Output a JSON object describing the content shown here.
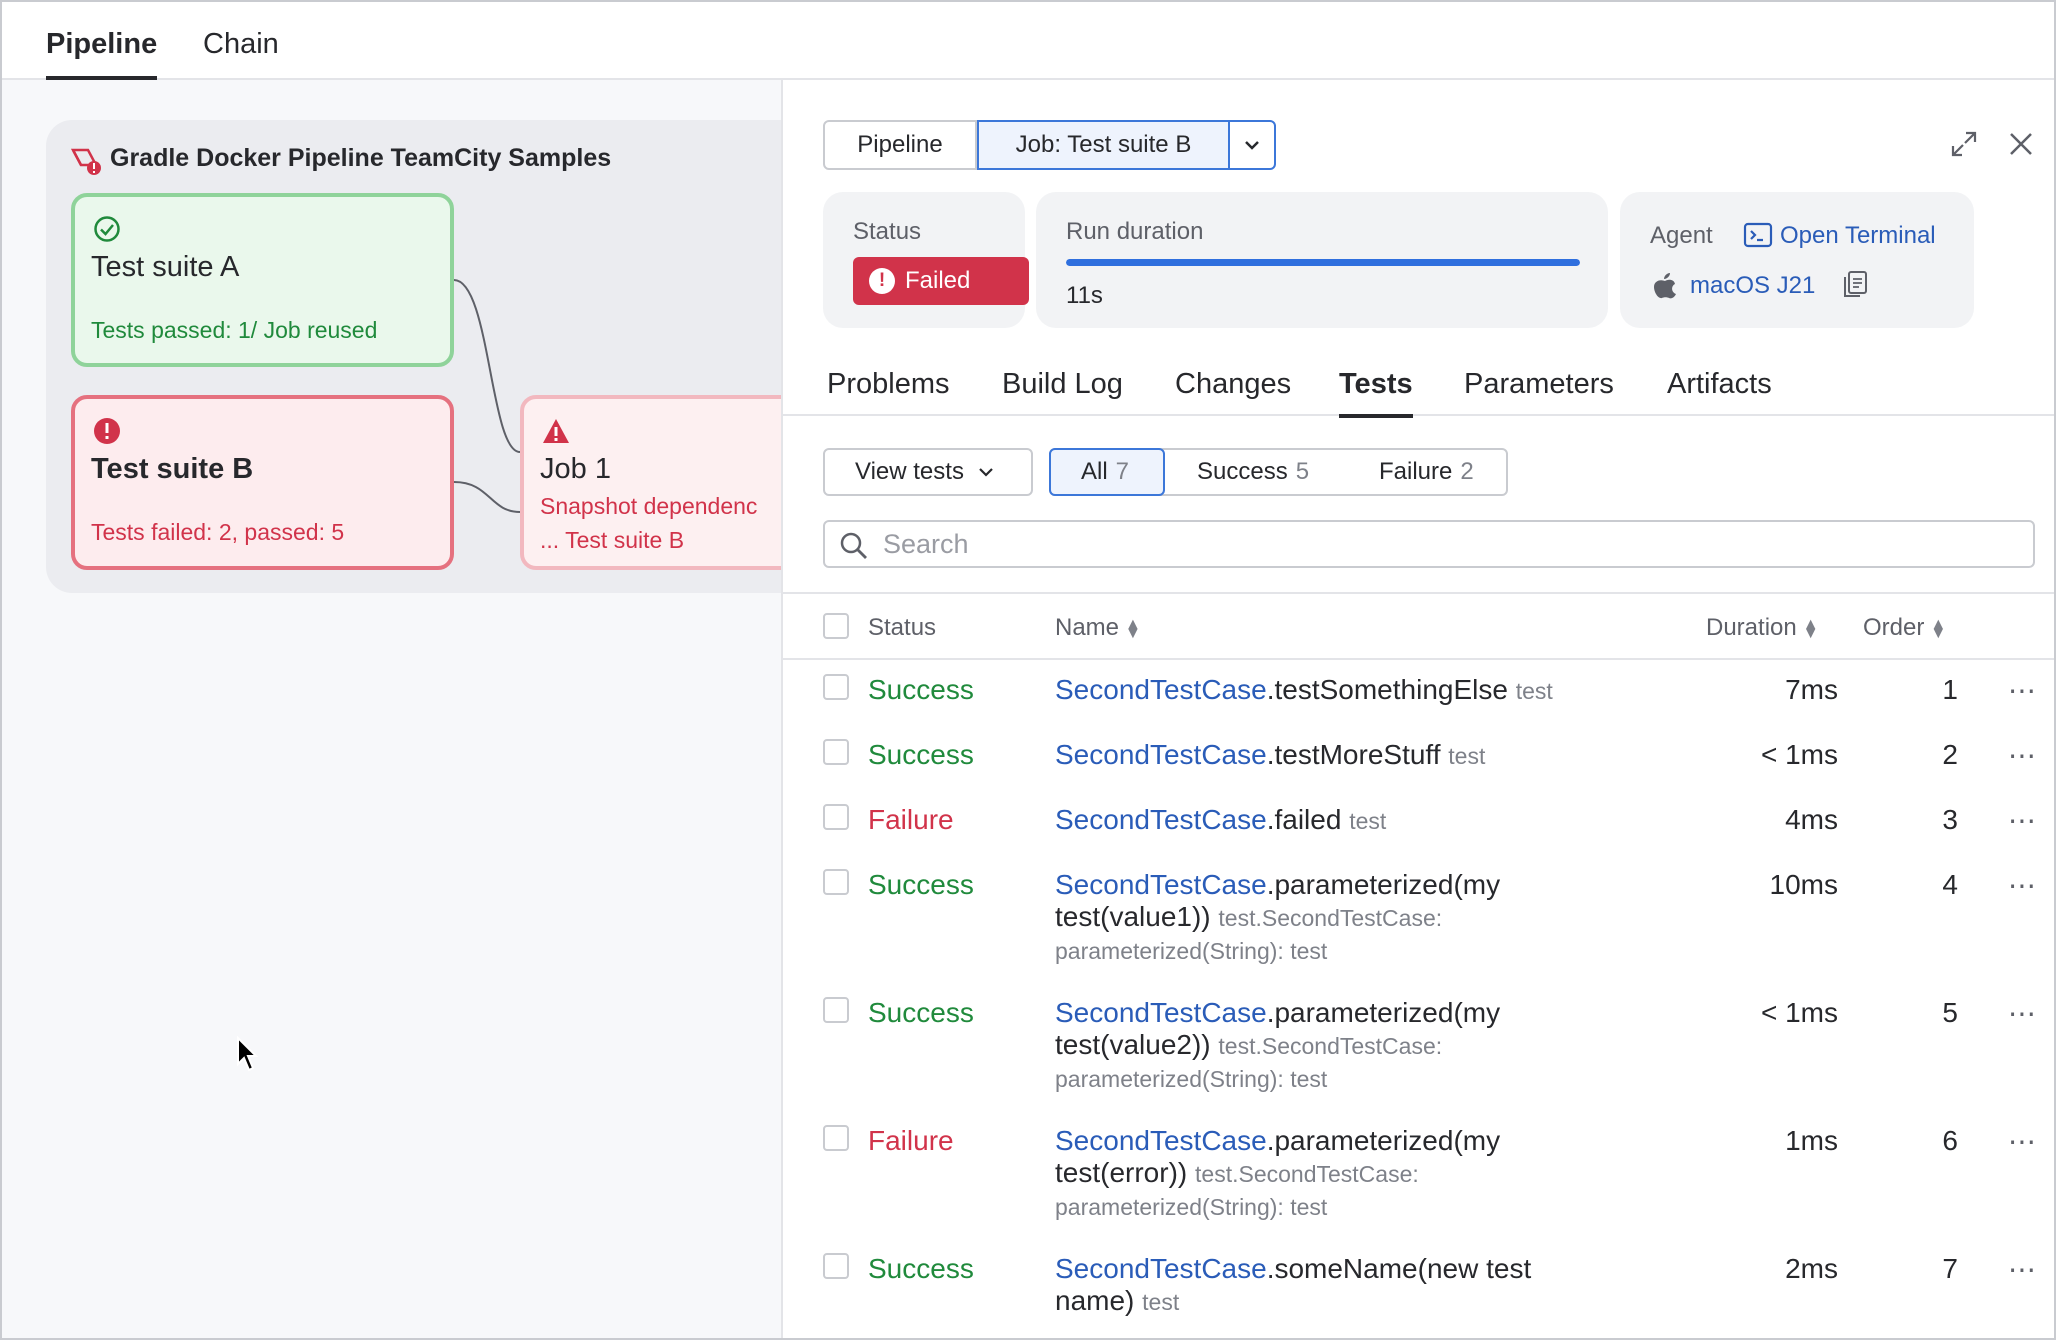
{
  "top_tabs": [
    {
      "label": "Pipeline"
    },
    {
      "label": "Chain"
    }
  ],
  "pipeline": {
    "title": "Gradle Docker Pipeline TeamCity Samples",
    "jobs": [
      {
        "name": "Test suite A",
        "status_text": "Tests passed: 1/ Job reused",
        "state": "success"
      },
      {
        "name": "Test suite B",
        "status_text": "Tests failed: 2, passed: 5",
        "state": "failed"
      },
      {
        "name": "Job 1",
        "status_line1": "Snapshot dependenc",
        "status_line2": "... Test suite B",
        "state": "warning"
      }
    ]
  },
  "panel": {
    "breadcrumb": {
      "pipeline": "Pipeline",
      "job": "Job: Test suite B"
    },
    "status": {
      "label": "Status",
      "value": "Failed"
    },
    "run_duration": {
      "label": "Run duration",
      "value": "11s",
      "progress": 1.0
    },
    "agent": {
      "label": "Agent",
      "terminal": "Open Terminal",
      "name": "macOS J21"
    },
    "tabs": [
      "Problems",
      "Build Log",
      "Changes",
      "Tests",
      "Parameters",
      "Artifacts"
    ],
    "active_tab": "Tests",
    "view_tests": "View tests",
    "filters": [
      {
        "label": "All",
        "count": "7"
      },
      {
        "label": "Success",
        "count": "5"
      },
      {
        "label": "Failure",
        "count": "2"
      }
    ],
    "search_placeholder": "Search",
    "columns": {
      "status": "Status",
      "name": "Name",
      "duration": "Duration",
      "order": "Order"
    },
    "rows": [
      {
        "status": "Success",
        "cls": "SecondTestCase",
        "method": ".testSomethingElse",
        "pkg": "test",
        "duration": "7ms",
        "order": "1"
      },
      {
        "status": "Success",
        "cls": "SecondTestCase",
        "method": ".testMoreStuff",
        "pkg": "test",
        "duration": "< 1ms",
        "order": "2"
      },
      {
        "status": "Failure",
        "cls": "SecondTestCase",
        "method": ".failed",
        "pkg": "test",
        "duration": "4ms",
        "order": "3"
      },
      {
        "status": "Success",
        "cls": "SecondTestCase",
        "method": ".parameterized(my test(value1))",
        "pkg": "test.SecondTestCase: parameterized(String): test",
        "duration": "10ms",
        "order": "4"
      },
      {
        "status": "Success",
        "cls": "SecondTestCase",
        "method": ".parameterized(my test(value2))",
        "pkg": "test.SecondTestCase: parameterized(String): test",
        "duration": "< 1ms",
        "order": "5"
      },
      {
        "status": "Failure",
        "cls": "SecondTestCase",
        "method": ".parameterized(my test(error))",
        "pkg": "test.SecondTestCase: parameterized(String): test",
        "duration": "1ms",
        "order": "6"
      },
      {
        "status": "Success",
        "cls": "SecondTestCase",
        "method": ".someName(new test name)",
        "pkg": "test",
        "duration": "2ms",
        "order": "7"
      }
    ]
  },
  "colors": {
    "success": "#208a3c",
    "failure": "#d1334a",
    "link": "#2a5cb8",
    "accent": "#2f6fde"
  }
}
